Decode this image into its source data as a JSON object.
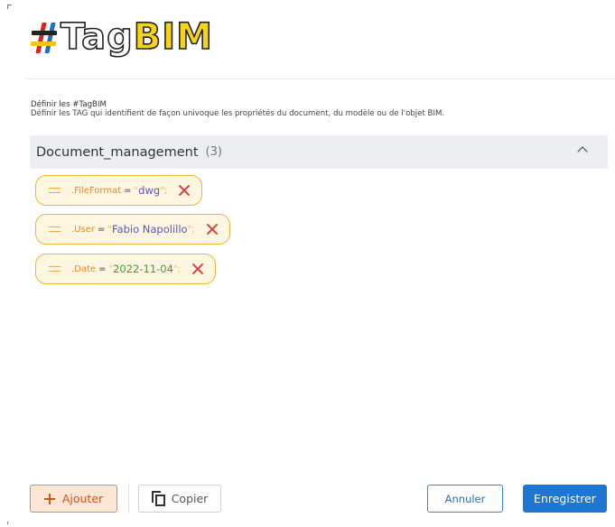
{
  "logo": {
    "hash": "#",
    "tag": "Tag",
    "bim": "BIM"
  },
  "section": {
    "heading": "Définir les #TagBIM",
    "description": "Définir les TAG qui identifient de façon univoque les propriétés du document, du modèle ou de l'objet BIM."
  },
  "group": {
    "title": "Document_management",
    "count": "(3)",
    "expanded": true
  },
  "tags": [
    {
      "key": ".FileFormat",
      "eq": "=",
      "open_quote": "\"",
      "value": "dwg",
      "close_quote": "\";",
      "value_color": "#5a55b0"
    },
    {
      "key": ".User",
      "eq": "=",
      "open_quote": "\"",
      "value": "Fabio Napolillo",
      "close_quote": "\";",
      "value_color": "#5a55b0"
    },
    {
      "key": ".Date",
      "eq": "=",
      "open_quote": "\"",
      "value": "2022-11-04",
      "close_quote": "\";",
      "value_color": "#3f9a3f"
    }
  ],
  "buttons": {
    "add": "Ajouter",
    "copy": "Copier",
    "cancel": "Annuler",
    "save": "Enregistrer"
  },
  "colors": {
    "accent": "#1f76d2",
    "tag_border": "#f0b43c",
    "tag_bg": "#fff6e2",
    "delete": "#d94040",
    "add_text": "#d0541f"
  }
}
